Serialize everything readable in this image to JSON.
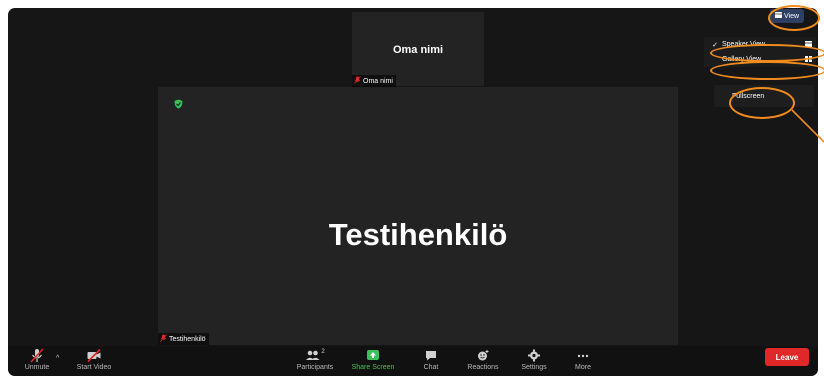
{
  "participants": {
    "small_tile": {
      "name": "Oma nimi",
      "label": "Oma nimi"
    },
    "main_tile": {
      "name": "Testihenkilö",
      "label": "Testihenkilö"
    }
  },
  "view_button": {
    "label": "View"
  },
  "view_menu": {
    "items": [
      {
        "label": "Speaker View",
        "checked": true
      },
      {
        "label": "Gallery View",
        "checked": false
      }
    ],
    "fullscreen_label": "Fullscreen"
  },
  "toolbar": {
    "unmute_label": "Unmute",
    "start_video_label": "Start Video",
    "participants_label": "Participants",
    "participants_count": "2",
    "share_screen_label": "Share Screen",
    "chat_label": "Chat",
    "reactions_label": "Reactions",
    "settings_label": "Settings",
    "more_label": "More",
    "leave_label": "Leave"
  },
  "colors": {
    "window_bg": "#161616",
    "tile_bg": "#232323",
    "share_green": "#4cbf5a",
    "leave_red": "#e02828",
    "view_button_blue": "#2e3f63",
    "highlight_orange": "#f28b1d"
  }
}
